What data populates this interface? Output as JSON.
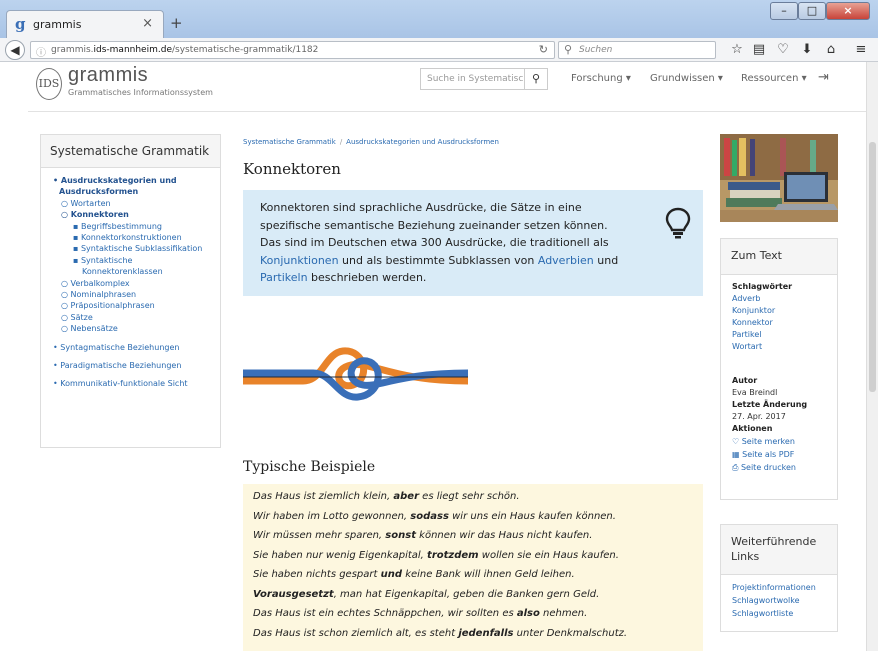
{
  "browser": {
    "tab_title": "grammis",
    "tab_favicon": "g",
    "url_prefix": "grammis.",
    "url_domain": "ids-mannheim.de",
    "url_path": "/systematische-grammatik/1182",
    "search_placeholder": "Suchen"
  },
  "header": {
    "logo_mark": "IDS",
    "logo_word": "grammis",
    "logo_subtitle": "Grammatisches Informationssystem",
    "search_placeholder": "Suche in Systematisch",
    "nav": [
      "Forschung ▾",
      "Grundwissen ▾",
      "Ressourcen ▾"
    ]
  },
  "left_panel": {
    "title": "Systematische Grammatik",
    "items": [
      {
        "text": "• Ausdruckskategorien und",
        "level": 0,
        "bold": true
      },
      {
        "text": "Ausdrucksformen",
        "level": 0,
        "bold": true,
        "cont": true
      },
      {
        "text": "○ Wortarten",
        "level": 1,
        "bold": false
      },
      {
        "text": "○ Konnektoren",
        "level": 1,
        "bold": true
      },
      {
        "text": "▪ Begriffsbestimmung",
        "level": 2,
        "bold": false
      },
      {
        "text": "▪ Konnektorkonstruktionen",
        "level": 2,
        "bold": false
      },
      {
        "text": "▪ Syntaktische Subklassifikation",
        "level": 2,
        "bold": false
      },
      {
        "text": "▪ Syntaktische",
        "level": 2,
        "bold": false
      },
      {
        "text": "Konnektorenklassen",
        "level": 2,
        "bold": false,
        "cont": true
      },
      {
        "text": "○ Verbalkomplex",
        "level": 1,
        "bold": false
      },
      {
        "text": "○ Nominalphrasen",
        "level": 1,
        "bold": false
      },
      {
        "text": "○ Präpositionalphrasen",
        "level": 1,
        "bold": false
      },
      {
        "text": "○ Sätze",
        "level": 1,
        "bold": false
      },
      {
        "text": "○ Nebensätze",
        "level": 1,
        "bold": false
      },
      {
        "text": "• Syntagmatische Beziehungen",
        "level": 0,
        "bold": false,
        "gap": true
      },
      {
        "text": "• Paradigmatische Beziehungen",
        "level": 0,
        "bold": false,
        "gap": true
      },
      {
        "text": "• Kommunikativ-funktionale Sicht",
        "level": 0,
        "bold": false,
        "gap": true
      }
    ]
  },
  "main": {
    "breadcrumb": [
      "Systematische Grammatik",
      "Ausdruckskategorien und Ausdrucksformen"
    ],
    "breadcrumb_sep": "/",
    "title": "Konnektoren",
    "intro_before": "Konnektoren sind sprachliche Ausdrücke, die Sätze in eine spezifische semantische Beziehung zueinander setzen können. Das sind im Deutschen etwa 300 Ausdrücke, die traditionell als ",
    "link_konjunktionen": "Konjunktionen",
    "intro_mid1": " und als bestimmte Subklassen von ",
    "link_adverbien": "Adverbien",
    "intro_mid2": " und ",
    "link_partikeln": "Partikeln",
    "intro_after": " beschrieben werden.",
    "examples_title": "Typische Beispiele",
    "examples": [
      {
        "pre": "Das Haus ist ziemlich klein, ",
        "bold": "aber",
        "post": " es liegt sehr schön."
      },
      {
        "pre": "Wir haben im Lotto gewonnen, ",
        "bold": "sodass",
        "post": " wir uns ein Haus kaufen können."
      },
      {
        "pre": "Wir müssen mehr sparen, ",
        "bold": "sonst",
        "post": " können wir das Haus nicht kaufen."
      },
      {
        "pre": "Sie haben nur wenig Eigenkapital, ",
        "bold": "trotzdem",
        "post": " wollen sie ein Haus kaufen."
      },
      {
        "pre": "Sie haben nichts gespart ",
        "bold": "und",
        "post": " keine Bank will ihnen Geld leihen."
      },
      {
        "pre": "",
        "bold": "Vorausgesetzt",
        "post": ", man hat Eigenkapital, geben die Banken gern Geld."
      },
      {
        "pre": "Das Haus ist ein echtes Schnäppchen, wir sollten es ",
        "bold": "also",
        "post": " nehmen."
      },
      {
        "pre": "Das Haus ist schon ziemlich alt, es steht ",
        "bold": "jedenfalls",
        "post": " unter Denkmalschutz."
      }
    ]
  },
  "right": {
    "box1_title": "Zum Text",
    "keywords_heading": "Schlagwörter",
    "keywords": [
      "Adverb",
      "Konjunktor",
      "Konnektor",
      "Partikel",
      "Wortart"
    ],
    "author_heading": "Autor",
    "author": "Eva Breindl",
    "changed_heading": "Letzte Änderung",
    "changed": "27. Apr. 2017",
    "actions_heading": "Aktionen",
    "actions": [
      "Seite merken",
      "Seite als PDF",
      "Seite drucken"
    ],
    "box2_title": "Weiterführende Links",
    "links": [
      "Projektinformationen",
      "Schlagwortwolke",
      "Schlagwortliste"
    ]
  },
  "colors": {
    "link": "#2a6ab0",
    "infobox": "#d9ebf7",
    "examples_bg": "#fdf7df",
    "rope_orange": "#e8832a",
    "rope_blue": "#3a6fb8"
  }
}
